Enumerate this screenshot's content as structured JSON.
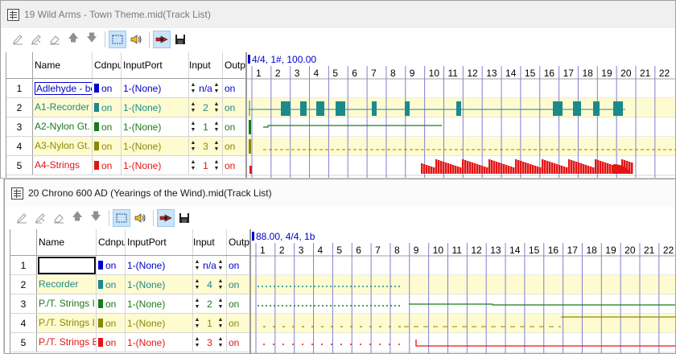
{
  "colors": {
    "teal": "#1a8a8a",
    "green": "#1a7a1a",
    "olive": "#8a8a00",
    "red": "#e41515",
    "blue": "#0000cc",
    "rowYellow": "#fffbd0",
    "measureLine": "#8080d0"
  },
  "windows": [
    {
      "title": "19 Wild Arms - Town Theme.mid(Track List)",
      "active": false,
      "columns": [
        "Name",
        "C",
        "dnput",
        "InputPort",
        "Input",
        "Outp"
      ],
      "header_info": "4/4, 1#, 100.00",
      "measures": [
        "1",
        "2",
        "3",
        "4",
        "5",
        "6",
        "7",
        "8",
        "9",
        "10",
        "11",
        "12",
        "13",
        "14",
        "15",
        "16",
        "17",
        "18",
        "19",
        "20",
        "21",
        "22"
      ],
      "tracks": [
        {
          "num": "1",
          "name": "Adlehyde - be",
          "color": "#0000cc",
          "nameColor": "#0000cc",
          "input": "on",
          "port": "1-(None)",
          "ch": "n/a",
          "out": "on",
          "focus": false
        },
        {
          "num": "2",
          "name": "A1-Recorder",
          "color": "#1a8a8a",
          "nameColor": "#1a8a8a",
          "input": "on",
          "port": "1-(None)",
          "ch": "2",
          "out": "on",
          "focus": false
        },
        {
          "num": "3",
          "name": "A2-Nylon Gt.",
          "color": "#1a7a1a",
          "nameColor": "#1a7a1a",
          "input": "on",
          "port": "1-(None)",
          "ch": "1",
          "out": "on",
          "focus": false
        },
        {
          "num": "4",
          "name": "A3-Nylon Gt.",
          "color": "#8a8a00",
          "nameColor": "#8a8a00",
          "input": "on",
          "port": "1-(None)",
          "ch": "3",
          "out": "on",
          "focus": false
        },
        {
          "num": "5",
          "name": "A4-Strings",
          "color": "#e41515",
          "nameColor": "#e41515",
          "input": "on",
          "port": "1-(None)",
          "ch": "1",
          "out": "on",
          "focus": false
        }
      ]
    },
    {
      "title": "20 Chrono 600 AD (Yearings of the Wind).mid(Track List)",
      "active": true,
      "columns": [
        "Name",
        "C",
        "dnput",
        "InputPort",
        "Input",
        "Outp"
      ],
      "header_info": "88.00, 4/4, 1b",
      "measures": [
        "1",
        "2",
        "3",
        "4",
        "5",
        "6",
        "7",
        "8",
        "9",
        "10",
        "11",
        "12",
        "13",
        "14",
        "15",
        "16",
        "17",
        "18",
        "19",
        "20",
        "21",
        "22"
      ],
      "tracks": [
        {
          "num": "1",
          "name": "",
          "color": "#0000cc",
          "nameColor": "#0000cc",
          "input": "on",
          "port": "1-(None)",
          "ch": "n/a",
          "out": "on",
          "focus": true
        },
        {
          "num": "2",
          "name": "Recorder",
          "color": "#1a8a8a",
          "nameColor": "#1a8a8a",
          "input": "on",
          "port": "1-(None)",
          "ch": "4",
          "out": "on",
          "focus": false
        },
        {
          "num": "3",
          "name": "P./T. Strings I",
          "color": "#1a7a1a",
          "nameColor": "#1a7a1a",
          "input": "on",
          "port": "1-(None)",
          "ch": "2",
          "out": "on",
          "focus": false
        },
        {
          "num": "4",
          "name": "P./T. Strings I",
          "color": "#8a8a00",
          "nameColor": "#8a8a00",
          "input": "on",
          "port": "1-(None)",
          "ch": "1",
          "out": "on",
          "focus": false
        },
        {
          "num": "5",
          "name": "P./T. Strings E",
          "color": "#e41515",
          "nameColor": "#e41515",
          "input": "on",
          "port": "1-(None)",
          "ch": "3",
          "out": "on",
          "focus": false
        }
      ]
    }
  ],
  "toolbar_icons": [
    "pencil-icon",
    "pencil-edit-icon",
    "eraser-icon",
    "arrow-up-icon",
    "arrow-down-icon",
    "select-rect-icon",
    "speaker-icon",
    "record-mode-icon",
    "save-icon"
  ]
}
